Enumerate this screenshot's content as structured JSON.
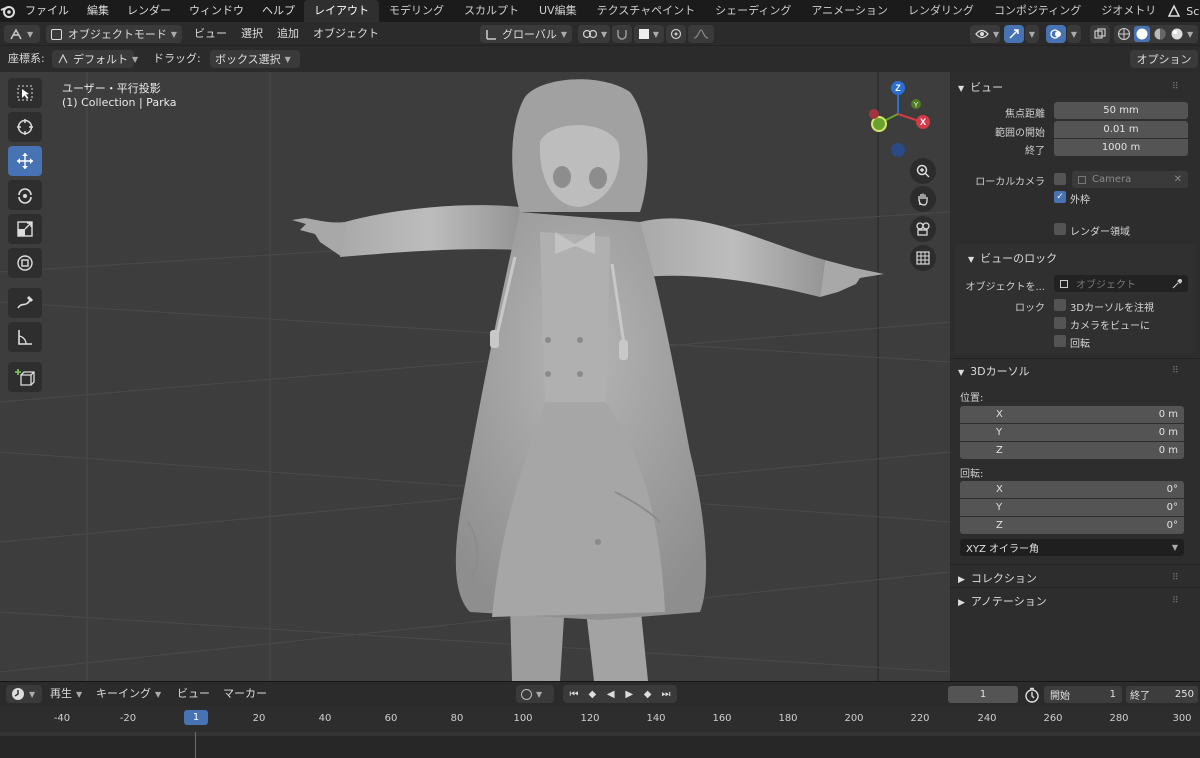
{
  "menubar": {
    "menus": [
      "ファイル",
      "編集",
      "レンダー",
      "ウィンドウ",
      "ヘルプ"
    ],
    "workspaces": [
      "レイアウト",
      "モデリング",
      "スカルプト",
      "UV編集",
      "テクスチャペイント",
      "シェーディング",
      "アニメーション",
      "レンダリング",
      "コンポジティング",
      "ジオメトリ"
    ],
    "active_workspace": "レイアウト",
    "scene_label": "Sc"
  },
  "header": {
    "mode": "オブジェクトモード",
    "menus": [
      "ビュー",
      "選択",
      "追加",
      "オブジェクト"
    ],
    "transform_orientation": "グローバル"
  },
  "header2": {
    "coord_label": "座標系:",
    "coord_value": "デフォルト",
    "drag_label": "ドラッグ:",
    "drag_value": "ボックス選択",
    "options": "オプション"
  },
  "viewport": {
    "view_name": "ユーザー・平行投影",
    "collection_info": "(1) Collection | Parka",
    "gizmo": {
      "x": "X",
      "y": "Y",
      "z": "Z"
    }
  },
  "tools": [
    "select-box-icon",
    "cursor-icon",
    "move-icon",
    "rotate-icon",
    "scale-icon",
    "transform-icon",
    "annotate-icon",
    "measure-icon",
    "add-cube-icon"
  ],
  "npanel": {
    "view_section": "ビュー",
    "focal_label": "焦点距離",
    "focal_value": "50 mm",
    "clip_start_label": "範囲の開始",
    "clip_start_value": "0.01 m",
    "clip_end_label": "終了",
    "clip_end_value": "1000 m",
    "local_camera_label": "ローカルカメラ",
    "camera_value": "Camera",
    "border_label": "外枠",
    "render_region_label": "レンダー領域",
    "view_lock_section": "ビューのロック",
    "lock_object_label": "オブジェクトを...",
    "lock_object_placeholder": "オブジェクト",
    "lock_label": "ロック",
    "lock_cursor_label": "3Dカーソルを注視",
    "lock_camera_label": "カメラをビューに",
    "lock_rotation_label": "回転",
    "cursor_section": "3Dカーソル",
    "location_label": "位置:",
    "loc_x_label": "X",
    "loc_x_value": "0 m",
    "loc_y_label": "Y",
    "loc_y_value": "0 m",
    "loc_z_label": "Z",
    "loc_z_value": "0 m",
    "rotation_label": "回転:",
    "rot_x_label": "X",
    "rot_x_value": "0°",
    "rot_y_label": "Y",
    "rot_y_value": "0°",
    "rot_z_label": "Z",
    "rot_z_value": "0°",
    "rotation_mode": "XYZ オイラー角",
    "collection_section": "コレクション",
    "annotation_section": "アノテーション"
  },
  "timeline": {
    "playback": "再生",
    "keying": "キーイング",
    "view": "ビュー",
    "marker": "マーカー",
    "current_frame": "1",
    "start_label": "開始",
    "start_value": "1",
    "end_label": "終了",
    "end_value": "250",
    "ruler_ticks": [
      "-40",
      "-20",
      "1",
      "20",
      "40",
      "60",
      "80",
      "100",
      "120",
      "140",
      "160",
      "180",
      "200",
      "220",
      "240",
      "260",
      "280",
      "300"
    ]
  }
}
